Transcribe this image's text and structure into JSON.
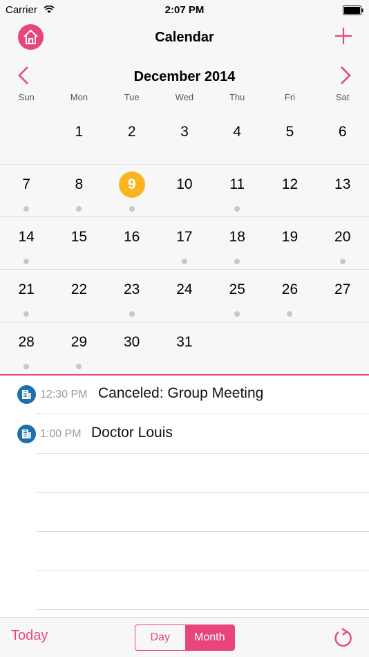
{
  "status_bar": {
    "carrier": "Carrier",
    "time": "2:07 PM"
  },
  "nav": {
    "title": "Calendar",
    "home_icon": "home-icon",
    "add_icon": "plus-icon"
  },
  "calendar": {
    "month_title": "December 2014",
    "weekdays": [
      "Sun",
      "Mon",
      "Tue",
      "Wed",
      "Thu",
      "Fri",
      "Sat"
    ],
    "today": 9,
    "weeks": [
      [
        null,
        {
          "d": "1",
          "dot": false
        },
        {
          "d": "2",
          "dot": false
        },
        {
          "d": "3",
          "dot": false
        },
        {
          "d": "4",
          "dot": false
        },
        {
          "d": "5",
          "dot": false
        },
        {
          "d": "6",
          "dot": false
        }
      ],
      [
        {
          "d": "7",
          "dot": true
        },
        {
          "d": "8",
          "dot": true
        },
        {
          "d": "9",
          "dot": true
        },
        {
          "d": "10",
          "dot": false
        },
        {
          "d": "11",
          "dot": true
        },
        {
          "d": "12",
          "dot": false
        },
        {
          "d": "13",
          "dot": false
        }
      ],
      [
        {
          "d": "14",
          "dot": true
        },
        {
          "d": "15",
          "dot": false
        },
        {
          "d": "16",
          "dot": false
        },
        {
          "d": "17",
          "dot": true
        },
        {
          "d": "18",
          "dot": true
        },
        {
          "d": "19",
          "dot": false
        },
        {
          "d": "20",
          "dot": true
        }
      ],
      [
        {
          "d": "21",
          "dot": true
        },
        {
          "d": "22",
          "dot": false
        },
        {
          "d": "23",
          "dot": true
        },
        {
          "d": "24",
          "dot": false
        },
        {
          "d": "25",
          "dot": true
        },
        {
          "d": "26",
          "dot": true
        },
        {
          "d": "27",
          "dot": false
        }
      ],
      [
        {
          "d": "28",
          "dot": true
        },
        {
          "d": "29",
          "dot": true
        },
        {
          "d": "30",
          "dot": false
        },
        {
          "d": "31",
          "dot": false
        },
        null,
        null,
        null
      ]
    ]
  },
  "events": [
    {
      "time": "12:30 PM",
      "title": "Canceled: Group Meeting",
      "icon": "building-icon"
    },
    {
      "time": "1:00 PM",
      "title": "Doctor Louis",
      "icon": "building-icon"
    }
  ],
  "toolbar": {
    "today_label": "Today",
    "seg_day": "Day",
    "seg_month": "Month",
    "selected": "Month",
    "refresh_icon": "refresh-icon"
  },
  "colors": {
    "accent": "#e8457d",
    "today_circle": "#f8b51e",
    "event_icon": "#1e6fad",
    "dot": "#c8c8c8"
  }
}
